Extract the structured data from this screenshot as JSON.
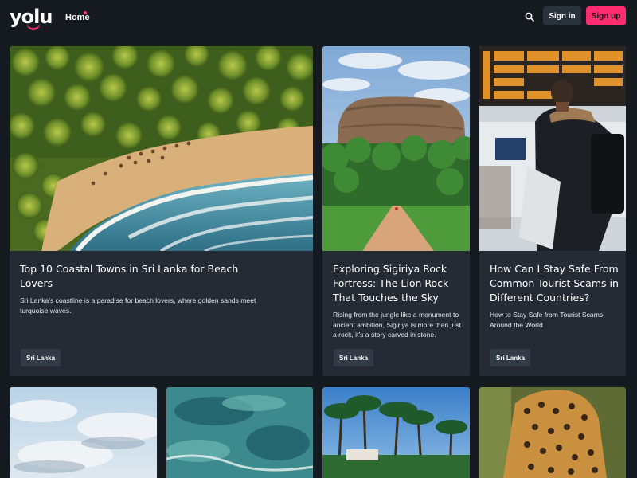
{
  "header": {
    "logo_text": "yolu",
    "nav": [
      {
        "label": "Home",
        "active": true
      }
    ],
    "signin_label": "Sign in",
    "signup_label": "Sign up",
    "icons": {
      "search": "search-icon"
    }
  },
  "colors": {
    "background": "#151a21",
    "card": "#242b34",
    "accent": "#ff2d6f",
    "tag": "#323a45"
  },
  "cards": [
    {
      "title": "Top 10 Coastal Towns in Sri Lanka for Beach Lovers",
      "excerpt": "Sri Lanka's coastline is a paradise for beach lovers, where golden sands meet turquoise waves.",
      "tag": "Sri Lanka"
    },
    {
      "title": "Exploring Sigiriya Rock Fortress: The Lion Rock That Touches the Sky",
      "excerpt": "Rising from the jungle like a monument to ancient ambition, Sigiriya is more than just a rock, it's a story carved in stone.",
      "tag": "Sri Lanka"
    },
    {
      "title": "How Can I Stay Safe From Common Tourist Scams in Different Countries?",
      "excerpt": "How to Stay Safe from Tourist Scams Around the World",
      "tag": "Sri Lanka"
    }
  ]
}
